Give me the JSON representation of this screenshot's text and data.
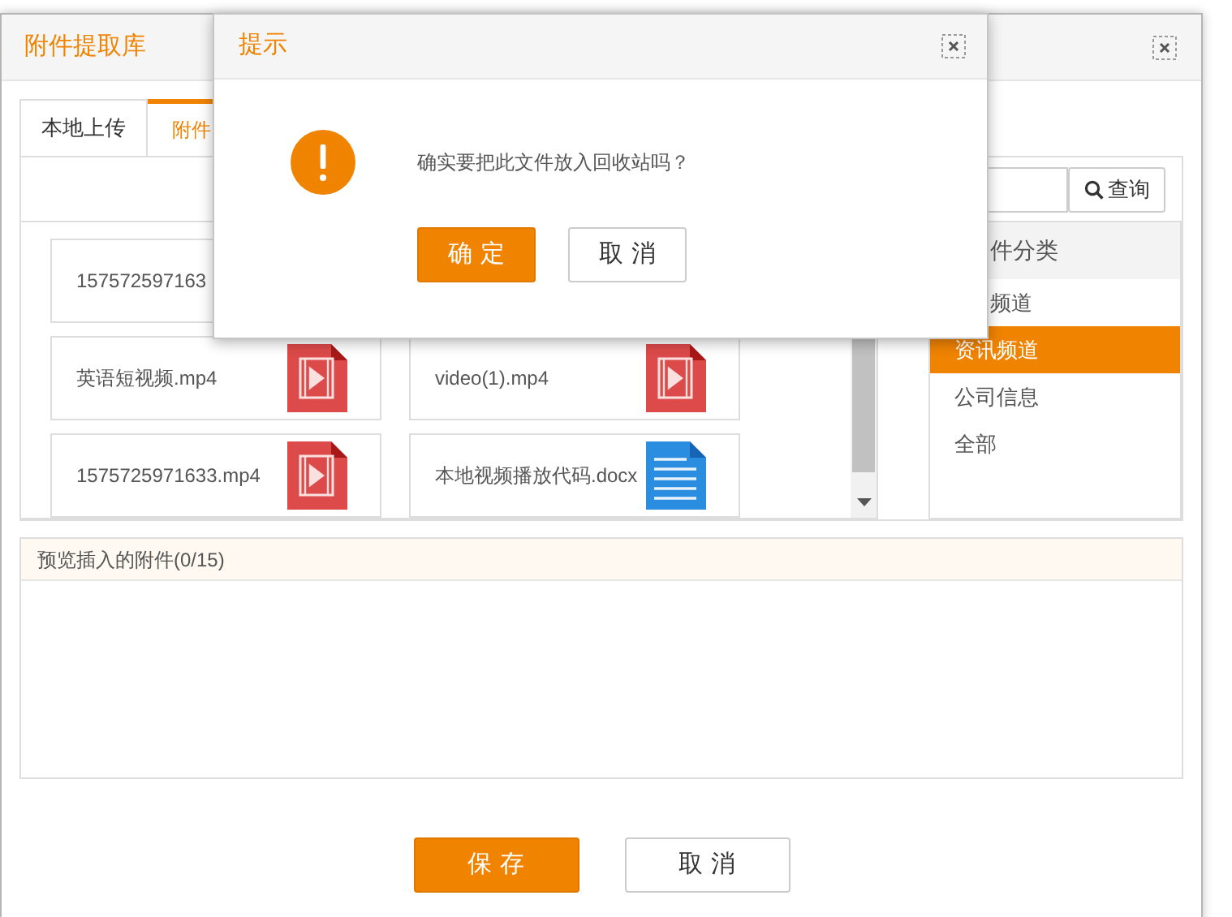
{
  "dialog": {
    "title": "附件提取库"
  },
  "tabs": [
    {
      "label": "本地上传",
      "selected": false
    },
    {
      "label": "附件",
      "selected": true
    }
  ],
  "search": {
    "button": "查询"
  },
  "files": [
    {
      "name": "157572597163"
    },
    {
      "name": "英语短视频.mp4",
      "kind": "video"
    },
    {
      "name": "video(1).mp4",
      "kind": "video"
    },
    {
      "name": "1575725971633.mp4",
      "kind": "video"
    },
    {
      "name": "本地视频播放代码.docx",
      "kind": "document"
    }
  ],
  "category": {
    "title": "件分类",
    "items": [
      {
        "label": "频道",
        "selected": false
      },
      {
        "label": "资讯频道",
        "selected": true
      },
      {
        "label": "公司信息",
        "selected": false
      },
      {
        "label": "全部",
        "selected": false
      }
    ]
  },
  "preview": {
    "title": "预览插入的附件(0/15)"
  },
  "buttons": [
    {
      "label": "保存",
      "kind": "primary"
    },
    {
      "label": "取消",
      "kind": "default"
    }
  ],
  "confirm": {
    "title": "提示",
    "message": "确实要把此文件放入回收站吗？",
    "buttons": [
      {
        "label": "确定",
        "kind": "primary"
      },
      {
        "label": "取消",
        "kind": "default"
      }
    ]
  }
}
